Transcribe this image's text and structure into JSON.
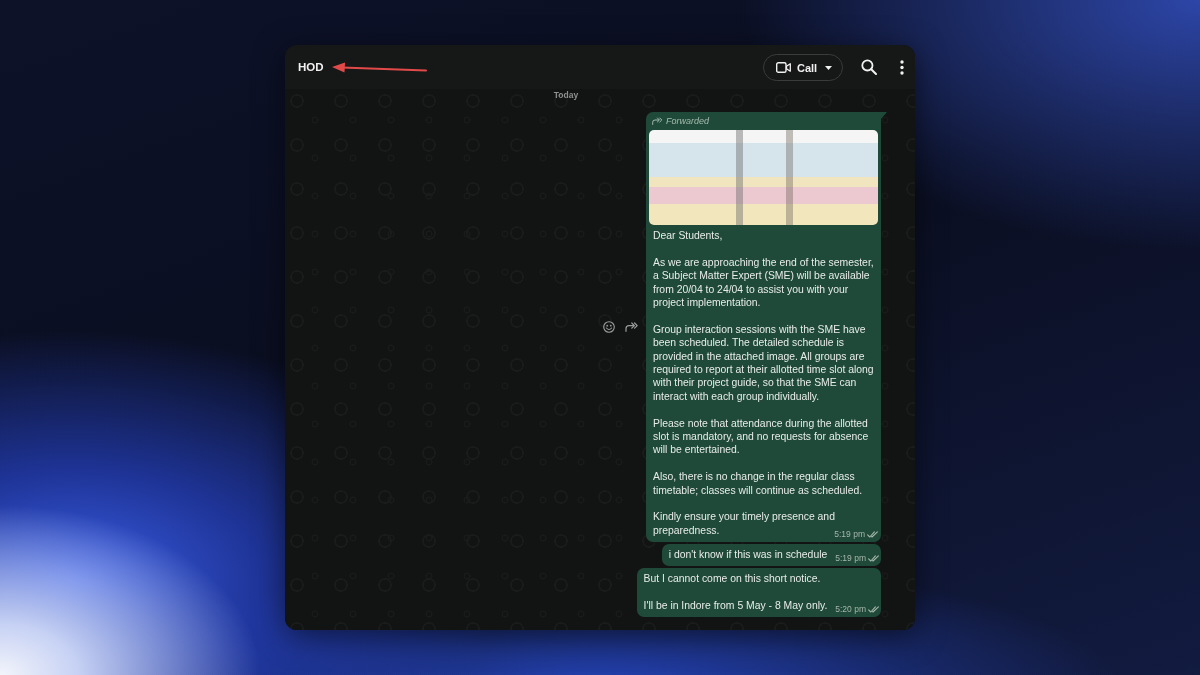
{
  "window": {
    "title": "HOD"
  },
  "annotation": {
    "kind": "arrow"
  },
  "header": {
    "call_button": {
      "label": "Call"
    }
  },
  "chat": {
    "date_label": "Today",
    "messages": [
      {
        "tail": true,
        "hover_actions": true,
        "forwarded": true,
        "forwarded_label": "Forwarded",
        "attachment": {
          "kind": "image"
        },
        "paragraphs": [
          "Dear Students,",
          "As we are approaching the end of the semester, a Subject Matter Expert (SME) will be available from 20/04 to 24/04 to assist you with your project implementation.",
          "Group interaction sessions with the SME have been scheduled. The detailed schedule is provided in the attached image. All groups are required to report at their allotted time slot along with their project guide, so that the SME can interact with each group individually.",
          "Please note that attendance during the allotted slot is mandatory, and no requests for absence will be entertained.",
          "Also, there is no change in the regular class timetable; classes will continue as scheduled.",
          "Kindly ensure your timely presence and preparedness."
        ],
        "time": "5:19 pm",
        "read": false
      },
      {
        "tail": false,
        "hover_actions": false,
        "forwarded": false,
        "paragraphs": [
          "i don't know if this was in schedule"
        ],
        "time": "5:19 pm",
        "read": false
      },
      {
        "tail": false,
        "hover_actions": false,
        "forwarded": false,
        "paragraphs": [
          "But I cannot come on this short notice.",
          "I'll be in Indore from 5 May - 8 May only."
        ],
        "time": "5:20 pm",
        "read": false
      }
    ]
  }
}
